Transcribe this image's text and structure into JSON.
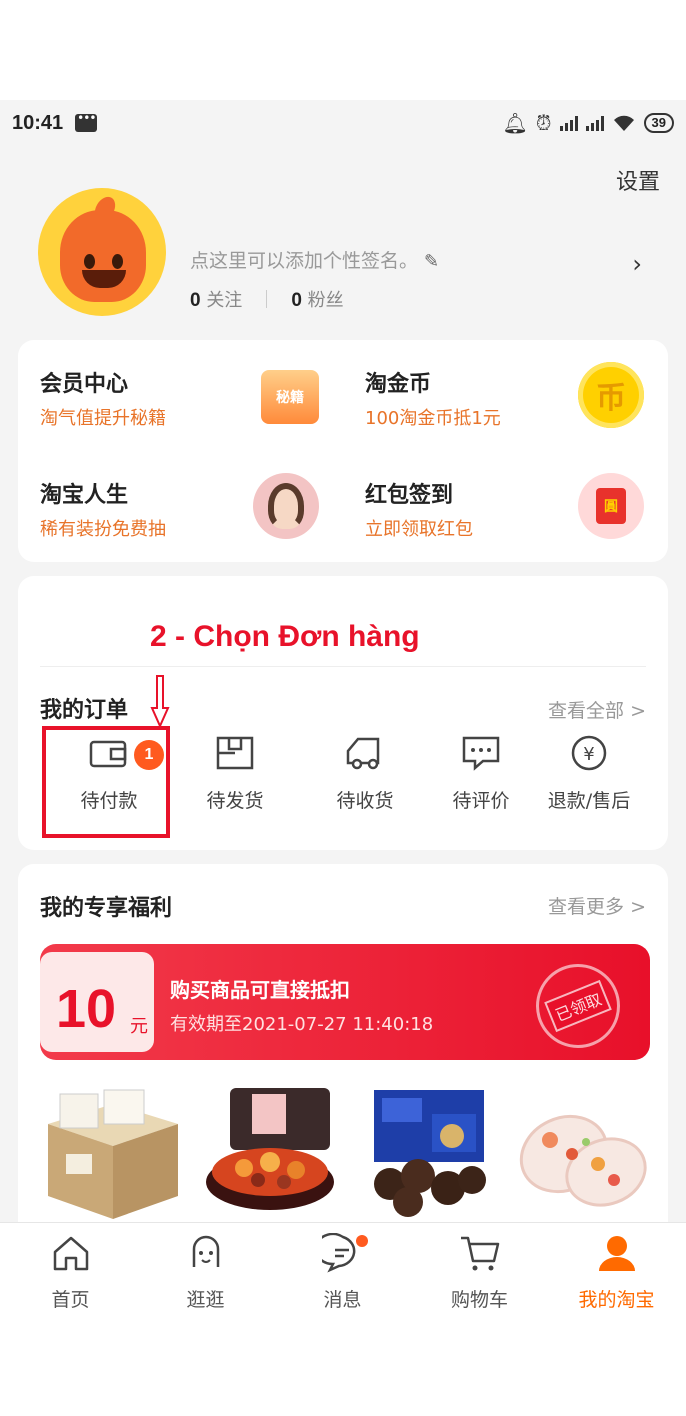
{
  "status_bar": {
    "time": "10:41",
    "battery": "39"
  },
  "header": {
    "settings_label": "设置"
  },
  "profile": {
    "signature_placeholder": "点这里可以添加个性签名。",
    "following_count": "0",
    "following_label": "关注",
    "followers_count": "0",
    "followers_label": "粉丝"
  },
  "services": [
    {
      "title": "会员中心",
      "subtitle": "淘气值提升秘籍",
      "icon": "vip-badge-icon",
      "icon_text": "秘籍"
    },
    {
      "title": "淘金币",
      "subtitle": "100淘金币抵1元",
      "icon": "gold-coin-icon",
      "icon_text": "币"
    },
    {
      "title": "淘宝人生",
      "subtitle": "稀有装扮免费抽",
      "icon": "avatar-girl-icon"
    },
    {
      "title": "红包签到",
      "subtitle": "立即领取红包",
      "icon": "red-envelope-icon",
      "icon_text": "圓"
    }
  ],
  "instruction": "2 - Chọn Đơn hàng",
  "orders": {
    "title": "我的订单",
    "view_all": "查看全部 >",
    "items": [
      {
        "label": "待付款",
        "icon": "wallet-icon",
        "badge": "1"
      },
      {
        "label": "待发货",
        "icon": "package-icon"
      },
      {
        "label": "待收货",
        "icon": "delivery-truck-icon"
      },
      {
        "label": "待评价",
        "icon": "comment-icon"
      },
      {
        "label": "退款/售后",
        "icon": "refund-icon"
      }
    ]
  },
  "benefits": {
    "title": "我的专享福利",
    "view_more": "查看更多 >",
    "coupon": {
      "amount": "10",
      "unit": "元",
      "title": "购买商品可直接抵扣",
      "expiry": "有效期至2021-07-27 11:40:18",
      "stamp": "已领取"
    },
    "products": [
      "tissue-box-product",
      "hotpot-product",
      "chocolate-box-product",
      "slippers-product"
    ]
  },
  "tabbar": [
    {
      "label": "首页",
      "icon": "home-icon"
    },
    {
      "label": "逛逛",
      "icon": "browse-face-icon"
    },
    {
      "label": "消息",
      "icon": "message-icon"
    },
    {
      "label": "购物车",
      "icon": "cart-icon"
    },
    {
      "label": "我的淘宝",
      "icon": "user-icon",
      "active": true
    }
  ],
  "colors": {
    "accent": "#ff6a00",
    "annotation_red": "#e8122a",
    "coupon_red": "#e8102a"
  }
}
